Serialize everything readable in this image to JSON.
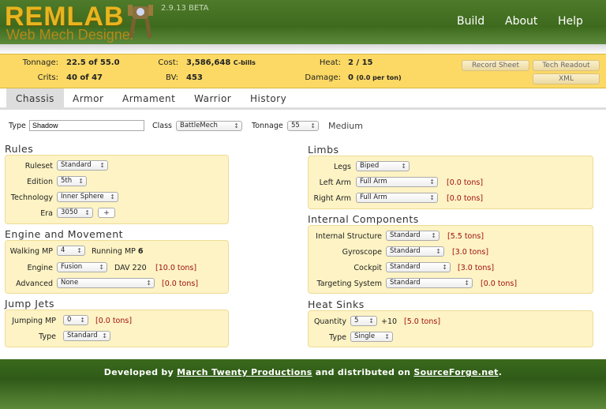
{
  "header": {
    "logo": "REMLAB",
    "logo_sub": "Web Mech Designer",
    "version": "2.9.13 BETA",
    "nav": [
      "Build",
      "About",
      "Help"
    ]
  },
  "summary": {
    "tonnage_label": "Tonnage:",
    "tonnage": "22.5 of 55.0",
    "crits_label": "Crits:",
    "crits": "40 of 47",
    "cost_label": "Cost:",
    "cost": "3,586,648",
    "cost_unit": "C-bills",
    "bv_label": "BV:",
    "bv": "453",
    "heat_label": "Heat:",
    "heat": "2 / 15",
    "damage_label": "Damage:",
    "damage": "0",
    "damage_per": "(0.0 per ton)",
    "buttons": {
      "record": "Record Sheet",
      "tech": "Tech Readout",
      "xml": "XML"
    }
  },
  "tabs": [
    "Chassis",
    "Armor",
    "Armament",
    "Warrior",
    "History"
  ],
  "chassis": {
    "type_label": "Type",
    "type": "Shadow",
    "class_label": "Class",
    "class": "BattleMech",
    "tonnage_label": "Tonnage",
    "tonnage": "55",
    "weight_class": "Medium"
  },
  "rules": {
    "title": "Rules",
    "ruleset_label": "Ruleset",
    "ruleset": "Standard",
    "edition_label": "Edition",
    "edition": "5th",
    "tech_label": "Technology",
    "tech": "Inner Sphere",
    "era_label": "Era",
    "era": "3050",
    "add": "+"
  },
  "engine": {
    "title": "Engine and Movement",
    "walk_label": "Walking MP",
    "walk": "4",
    "run_label": "Running MP",
    "run": "6",
    "engine_label": "Engine",
    "engine": "Fusion",
    "dav": "DAV 220",
    "engine_tons": "[10.0 tons]",
    "adv_label": "Advanced",
    "adv": "None",
    "adv_tons": "[0.0 tons]"
  },
  "jump": {
    "title": "Jump Jets",
    "mp_label": "Jumping MP",
    "mp": "0",
    "tons": "[0.0 tons]",
    "type_label": "Type",
    "type": "Standard"
  },
  "limbs": {
    "title": "Limbs",
    "legs_label": "Legs",
    "legs": "Biped",
    "la_label": "Left Arm",
    "la": "Full Arm",
    "la_tons": "[0.0 tons]",
    "ra_label": "Right Arm",
    "ra": "Full Arm",
    "ra_tons": "[0.0 tons]"
  },
  "internal": {
    "title": "Internal Components",
    "is_label": "Internal Structure",
    "is": "Standard",
    "is_tons": "[5.5 tons]",
    "gyro_label": "Gyroscope",
    "gyro": "Standard",
    "gyro_tons": "[3.0 tons]",
    "cockpit_label": "Cockpit",
    "cockpit": "Standard",
    "cockpit_tons": "[3.0 tons]",
    "ts_label": "Targeting System",
    "ts": "Standard",
    "ts_tons": "[0.0 tons]"
  },
  "heat": {
    "title": "Heat Sinks",
    "qty_label": "Quantity",
    "qty": "5",
    "plus": "+10",
    "tons": "[5.0 tons]",
    "type_label": "Type",
    "type": "Single"
  },
  "footer": {
    "t1": "Developed by ",
    "link1": "March Twenty Productions",
    "t2": " and distributed on ",
    "link2": "SourceForge.net",
    "t3": "."
  }
}
